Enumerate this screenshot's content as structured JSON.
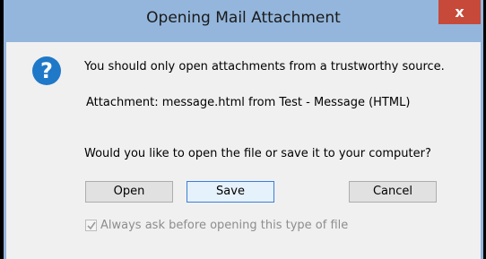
{
  "window": {
    "title": "Opening Mail Attachment",
    "close_label": "x"
  },
  "message": {
    "icon": "question-icon",
    "icon_glyph": "?",
    "warning": "You should only open attachments from a trustworthy source.",
    "attachment": "Attachment: message.html from Test - Message (HTML)",
    "question": "Would you like to open the file or save it to your computer?"
  },
  "buttons": {
    "open": "Open",
    "save": "Save",
    "cancel": "Cancel"
  },
  "checkbox": {
    "label": "Always ask before opening this type of file",
    "checked": true,
    "enabled": false
  },
  "colors": {
    "titlebar": "#94b6dc",
    "close": "#c7493a",
    "icon": "#1f78c8"
  }
}
